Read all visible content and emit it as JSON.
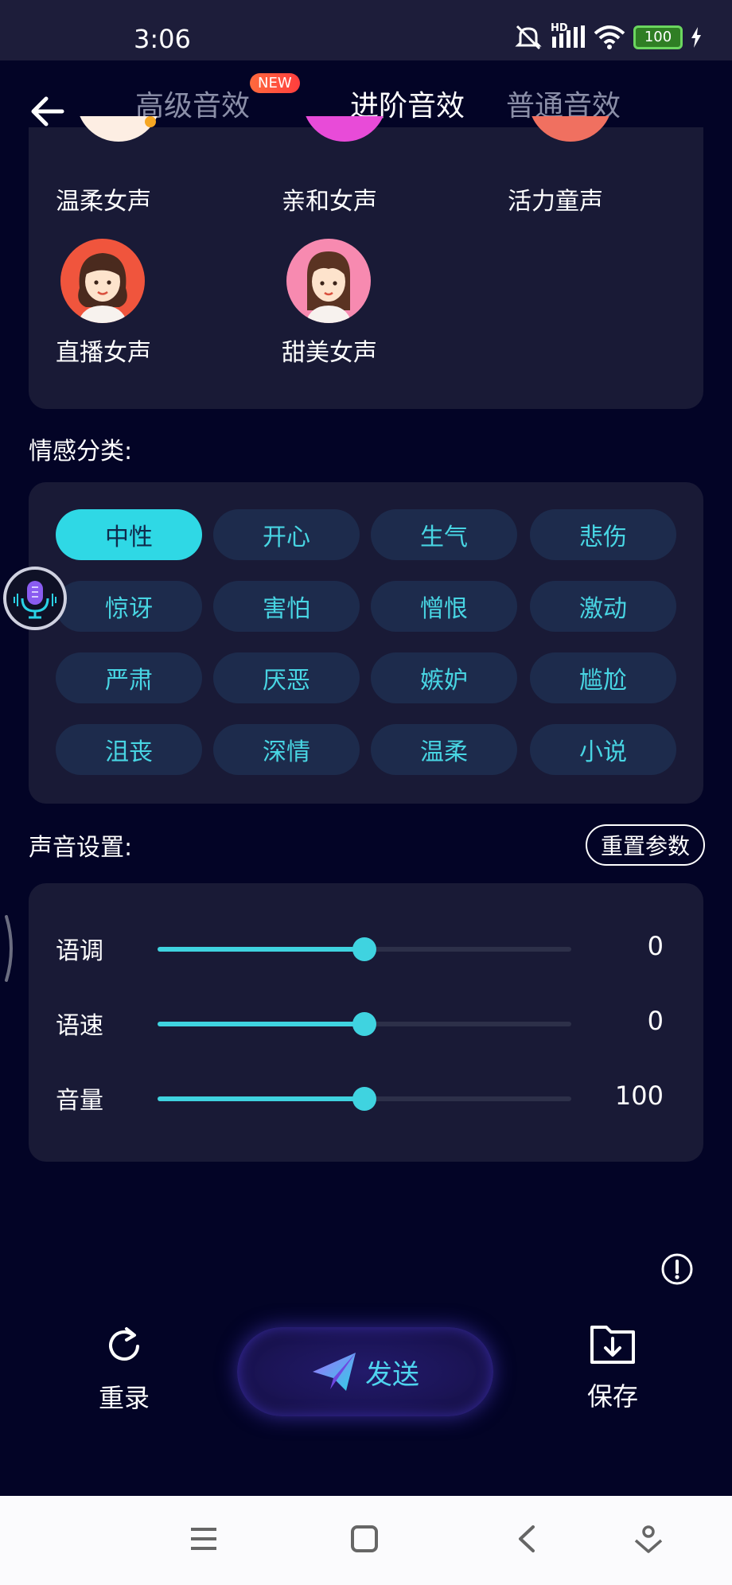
{
  "status_bar": {
    "time": "3:06",
    "network": "HD",
    "battery": "100"
  },
  "header": {
    "tabs": [
      {
        "label": "高级音效",
        "badge": "NEW"
      },
      {
        "label": "进阶音效"
      },
      {
        "label": "普通音效"
      }
    ],
    "active_tab": "进阶音效"
  },
  "voices": {
    "row1": [
      "温柔女声",
      "亲和女声",
      "活力童声"
    ],
    "row2": [
      "直播女声",
      "甜美女声"
    ]
  },
  "emotion": {
    "title": "情感分类:",
    "selected": "中性",
    "chips": [
      "中性",
      "开心",
      "生气",
      "悲伤",
      "惊讶",
      "害怕",
      "憎恨",
      "激动",
      "严肃",
      "厌恶",
      "嫉妒",
      "尴尬",
      "沮丧",
      "深情",
      "温柔",
      "小说"
    ]
  },
  "sound_settings": {
    "title": "声音设置:",
    "reset_label": "重置参数",
    "sliders": [
      {
        "label": "语调",
        "value": "0",
        "level": 0.5
      },
      {
        "label": "语速",
        "value": "0",
        "level": 0.5
      },
      {
        "label": "音量",
        "value": "100",
        "level": 0.5
      }
    ]
  },
  "actions": {
    "rerecord": "重录",
    "send": "发送",
    "save": "保存"
  },
  "colors": {
    "accent": "#3fd3e0",
    "background": "#030426",
    "card": "#191a36",
    "chip": "#1d2b4c"
  }
}
